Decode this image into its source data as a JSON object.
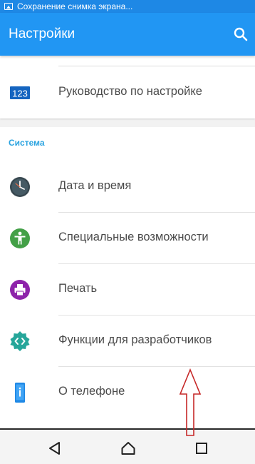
{
  "status_bar": {
    "notification_text": "Сохранение снимка экрана...",
    "icon": "screenshot-notification-icon"
  },
  "app_bar": {
    "title": "Настройки",
    "search_icon": "search-icon"
  },
  "top_section": {
    "items": [
      {
        "label": "Руководство по настройке",
        "icon": "setup-guide-icon"
      }
    ]
  },
  "system_section": {
    "header": "Система",
    "items": [
      {
        "label": "Дата и время",
        "icon": "clock-icon"
      },
      {
        "label": "Специальные возможности",
        "icon": "accessibility-icon"
      },
      {
        "label": "Печать",
        "icon": "printer-icon"
      },
      {
        "label": "Функции для разработчиков",
        "icon": "developer-options-icon"
      },
      {
        "label": "О телефоне",
        "icon": "phone-info-icon"
      }
    ]
  },
  "setup_icon_text": "123",
  "nav_bar": {
    "back": "back-icon",
    "home": "home-icon",
    "recents": "recents-icon"
  },
  "colors": {
    "app_bar": "#2196f3",
    "status_bar": "#1e88e5",
    "section_header": "#29a3e0",
    "annotation": "#c62828"
  }
}
